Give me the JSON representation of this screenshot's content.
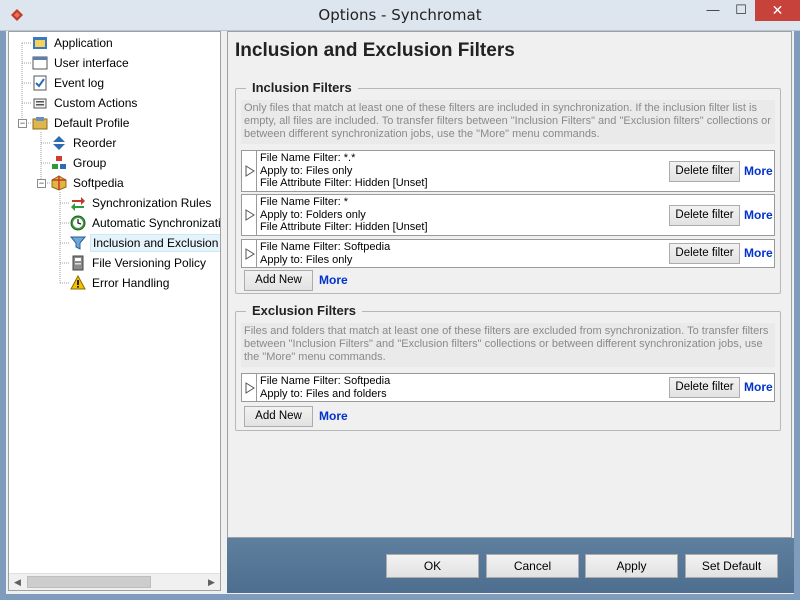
{
  "window": {
    "title": "Options - Synchromat",
    "minimize": "—",
    "maximize": "☐",
    "close": "✕"
  },
  "tree": {
    "items": [
      {
        "label": "Application",
        "icon": "application-icon"
      },
      {
        "label": "User interface",
        "icon": "user-interface-icon"
      },
      {
        "label": "Event log",
        "icon": "event-log-icon"
      },
      {
        "label": "Custom Actions",
        "icon": "custom-actions-icon"
      },
      {
        "label": "Default Profile",
        "icon": "profile-icon"
      },
      {
        "label": "Reorder",
        "icon": "reorder-icon"
      },
      {
        "label": "Group",
        "icon": "group-icon"
      },
      {
        "label": "Softpedia",
        "icon": "job-icon"
      },
      {
        "label": "Synchronization Rules",
        "icon": "sync-rules-icon"
      },
      {
        "label": "Automatic Synchronization",
        "icon": "clock-icon"
      },
      {
        "label": "Inclusion and Exclusion Filters",
        "icon": "filter-icon"
      },
      {
        "label": "File Versioning Policy",
        "icon": "versioning-icon"
      },
      {
        "label": "Error Handling",
        "icon": "warning-icon"
      }
    ]
  },
  "page": {
    "title": "Inclusion and Exclusion Filters"
  },
  "inclusion": {
    "title": "Inclusion Filters",
    "description": "Only files that match at least one of these filters are included in synchronization. If the inclusion filter list is empty, all files are included. To transfer filters between \"Inclusion Filters\" and \"Exclusion filters\" collections or between different synchronization jobs, use the \"More\" menu commands.",
    "filters": [
      {
        "lines": [
          "File Name Filter: *.*",
          "Apply to: Files only",
          "File Attribute Filter: Hidden [Unset]"
        ]
      },
      {
        "lines": [
          "File Name Filter: *",
          "Apply to: Folders only",
          "File Attribute Filter: Hidden [Unset]"
        ]
      },
      {
        "lines": [
          "File Name Filter: Softpedia",
          "Apply to: Files only"
        ]
      }
    ],
    "delete_label": "Delete filter",
    "more_label": "More",
    "add_label": "Add New"
  },
  "exclusion": {
    "title": "Exclusion Filters",
    "description": "Files and folders that match at least one of these filters are excluded from synchronization. To transfer filters between \"Inclusion Filters\" and \"Exclusion filters\" collections or between different synchronization jobs, use the \"More\" menu commands.",
    "filters": [
      {
        "lines": [
          "File Name Filter: Softpedia",
          "Apply to: Files and folders"
        ]
      }
    ],
    "delete_label": "Delete filter",
    "more_label": "More",
    "add_label": "Add New"
  },
  "buttons": {
    "ok": "OK",
    "cancel": "Cancel",
    "apply": "Apply",
    "set_default": "Set Default"
  },
  "colors": {
    "link": "#0033cc",
    "close_button": "#c7423b",
    "bottom_bar": "#5f7f9f"
  }
}
